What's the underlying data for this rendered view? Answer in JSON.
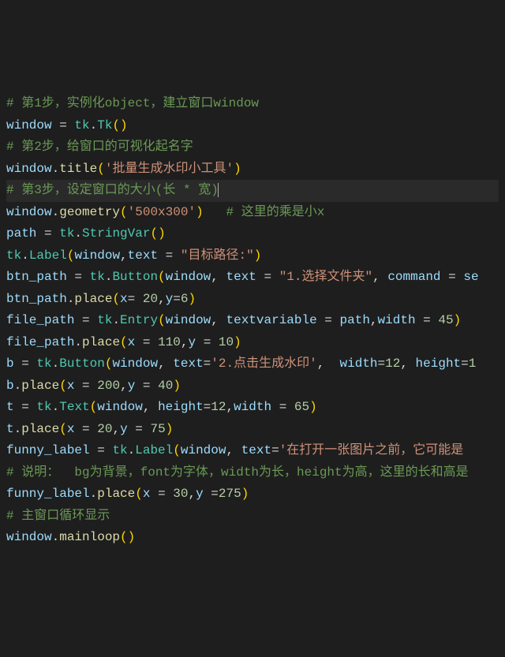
{
  "lines": {
    "l1_comment": "# 第1步，实例化object，建立窗口window",
    "l2_window": "window",
    "l2_eq": " = ",
    "l2_tk": "tk",
    "l2_dot": ".",
    "l2_Tk": "Tk",
    "l2_op": "(",
    "l2_cp": ")",
    "l3_comment": "# 第2步，给窗口的可视化起名字",
    "l4_window": "window",
    "l4_dot": ".",
    "l4_title": "title",
    "l4_op": "(",
    "l4_str": "'批量生成水印小工具'",
    "l4_cp": ")",
    "l5_comment": "# 第3步，设定窗口的大小(长 * 宽)",
    "l6_window": "window",
    "l6_dot": ".",
    "l6_geometry": "geometry",
    "l6_op": "(",
    "l6_str": "'500x300'",
    "l6_cp": ")",
    "l6_sp": "   ",
    "l6_comment": "# 这里的乘是小x",
    "l7_path": "path",
    "l7_eq": " = ",
    "l7_tk": "tk",
    "l7_dot": ".",
    "l7_SV": "StringVar",
    "l7_op": "(",
    "l7_cp": ")",
    "l8_tk": "tk",
    "l8_dot": ".",
    "l8_Label": "Label",
    "l8_op": "(",
    "l8_window": "window",
    "l8_c": ",",
    "l8_text": "text",
    "l8_eq": " = ",
    "l8_str": "\"目标路径:\"",
    "l8_cp": ")",
    "l9_btn": "btn_path",
    "l9_eq": " = ",
    "l9_tk": "tk",
    "l9_dot": ".",
    "l9_Button": "Button",
    "l9_op": "(",
    "l9_window": "window",
    "l9_c1": ", ",
    "l9_text": "text",
    "l9_eq2": " = ",
    "l9_str": "\"1.选择文件夹\"",
    "l9_c2": ", ",
    "l9_cmd": "command",
    "l9_eq3": " = ",
    "l9_se": "se",
    "l10_btn": "btn_path",
    "l10_dot": ".",
    "l10_place": "place",
    "l10_op": "(",
    "l10_x": "x",
    "l10_eq1": "= ",
    "l10_n1": "20",
    "l10_c": ",",
    "l10_y": "y",
    "l10_eq2": "=",
    "l10_n2": "6",
    "l10_cp": ")",
    "l11_fp": "file_path",
    "l11_eq": " = ",
    "l11_tk": "tk",
    "l11_dot": ".",
    "l11_Entry": "Entry",
    "l11_op": "(",
    "l11_window": "window",
    "l11_c1": ", ",
    "l11_tv": "textvariable",
    "l11_eq2": " = ",
    "l11_path": "path",
    "l11_c2": ",",
    "l11_width": "width",
    "l11_eq3": " = ",
    "l11_n": "45",
    "l11_cp": ")",
    "l12_fp": "file_path",
    "l12_dot": ".",
    "l12_place": "place",
    "l12_op": "(",
    "l12_x": "x",
    "l12_eq1": " = ",
    "l12_n1": "110",
    "l12_c": ",",
    "l12_y": "y",
    "l12_eq2": " = ",
    "l12_n2": "10",
    "l12_cp": ")",
    "l13_b": "b",
    "l13_eq": " = ",
    "l13_tk": "tk",
    "l13_dot": ".",
    "l13_Button": "Button",
    "l13_op": "(",
    "l13_window": "window",
    "l13_c1": ", ",
    "l13_text": "text",
    "l13_eq2": "=",
    "l13_str": "'2.点击生成水印'",
    "l13_c2": ",  ",
    "l13_width": "width",
    "l13_eq3": "=",
    "l13_n1": "12",
    "l13_c3": ", ",
    "l13_height": "height",
    "l13_eq4": "=",
    "l13_n2": "1",
    "l14_b": "b",
    "l14_dot": ".",
    "l14_place": "place",
    "l14_op": "(",
    "l14_x": "x",
    "l14_eq1": " = ",
    "l14_n1": "200",
    "l14_c": ",",
    "l14_y": "y",
    "l14_eq2": " = ",
    "l14_n2": "40",
    "l14_cp": ")",
    "l15_t": "t",
    "l15_eq": " = ",
    "l15_tk": "tk",
    "l15_dot": ".",
    "l15_Text": "Text",
    "l15_op": "(",
    "l15_window": "window",
    "l15_c1": ", ",
    "l15_height": "height",
    "l15_eq2": "=",
    "l15_n1": "12",
    "l15_c2": ",",
    "l15_width": "width",
    "l15_eq3": " = ",
    "l15_n2": "65",
    "l15_cp": ")",
    "l16_t": "t",
    "l16_dot": ".",
    "l16_place": "place",
    "l16_op": "(",
    "l16_x": "x",
    "l16_eq1": " = ",
    "l16_n1": "20",
    "l16_c": ",",
    "l16_y": "y",
    "l16_eq2": " = ",
    "l16_n2": "75",
    "l16_cp": ")",
    "l17_fl": "funny_label",
    "l17_eq": " = ",
    "l17_tk": "tk",
    "l17_dot": ".",
    "l17_Label": "Label",
    "l17_op": "(",
    "l17_window": "window",
    "l17_c": ", ",
    "l17_text": "text",
    "l17_eq2": "=",
    "l17_str": "'在打开一张图片之前，它可能是",
    "l18_comment": "# 说明：  bg为背景，font为字体，width为长，height为高，这里的长和高是",
    "l19_fl": "funny_label",
    "l19_dot": ".",
    "l19_place": "place",
    "l19_op": "(",
    "l19_x": "x",
    "l19_eq1": " = ",
    "l19_n1": "30",
    "l19_c": ",",
    "l19_y": "y",
    "l19_eq2": " =",
    "l19_n2": "275",
    "l19_cp": ")",
    "l20_comment": "# 主窗口循环显示",
    "l21_window": "window",
    "l21_dot": ".",
    "l21_mainloop": "mainloop",
    "l21_op": "(",
    "l21_cp": ")"
  }
}
